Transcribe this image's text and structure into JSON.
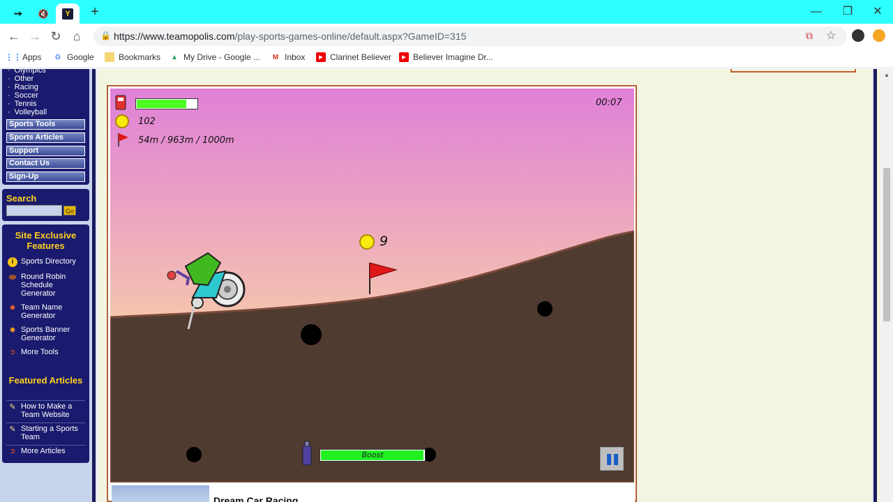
{
  "browser": {
    "tabs": [
      {
        "icon": "teamopolis-icon"
      },
      {
        "icon": "muted-speaker-icon"
      },
      {
        "icon": "teamopolis-y-icon",
        "active": true
      }
    ],
    "new_tab": "+",
    "window_controls": {
      "minimize": "—",
      "restore": "❐",
      "close": "✕"
    },
    "url_domain": "https://www.teamopolis.com",
    "url_path": "/play-sports-games-online/default.aspx?GameID=315",
    "bookmarks": [
      {
        "label": "Apps",
        "icon": "apps-grid-icon"
      },
      {
        "label": "Google",
        "icon": "google-icon"
      },
      {
        "label": "Bookmarks",
        "icon": "folder-icon"
      },
      {
        "label": "My Drive - Google ...",
        "icon": "drive-icon"
      },
      {
        "label": "Inbox",
        "icon": "gmail-icon"
      },
      {
        "label": "Clarinet Believer",
        "icon": "youtube-icon"
      },
      {
        "label": "Believer Imagine Dr...",
        "icon": "youtube-icon"
      }
    ]
  },
  "sidebar": {
    "sports": [
      "Olympics",
      "Other",
      "Racing",
      "Soccer",
      "Tennis",
      "Volleyball"
    ],
    "menu": [
      "Sports Tools",
      "Sports Articles",
      "Support",
      "Contact Us",
      "Sign-Up"
    ],
    "search": {
      "title": "Search",
      "go": "Go"
    },
    "features": {
      "title": "Site Exclusive Features",
      "items": [
        {
          "label": "Sports Directory",
          "icon": "info-icon"
        },
        {
          "label": "Round Robin Schedule Generator",
          "icon": "football-icon"
        },
        {
          "label": "Team Name Generator",
          "icon": "gear-icon"
        },
        {
          "label": "Sports Banner Generator",
          "icon": "gear-icon"
        },
        {
          "label": "More Tools",
          "icon": "arrow-circle-icon"
        }
      ]
    },
    "articles": {
      "title": "Featured Articles",
      "items": [
        {
          "label": "How to Make a Team Website",
          "icon": "note-icon"
        },
        {
          "label": "Starting a Sports Team",
          "icon": "note-icon"
        },
        {
          "label": "More Articles",
          "icon": "arrow-circle-icon"
        }
      ]
    }
  },
  "game": {
    "timer": "00:07",
    "coins": "102",
    "distance": "54m  / 963m  / 1000m",
    "coin_pickup": "9",
    "boost_label": "Boost",
    "fuel_level": 0.82,
    "boost_level": 0.99
  },
  "below": {
    "title": "Dream Car Racing"
  },
  "colors": {
    "tabbar": "#2effff",
    "sidebar_panel": "#1a1a6e",
    "sidebar_title": "#ffd21e",
    "ground": "#4f3b30",
    "sky_top": "#e080d8",
    "sky_bottom": "#fff8a0"
  }
}
